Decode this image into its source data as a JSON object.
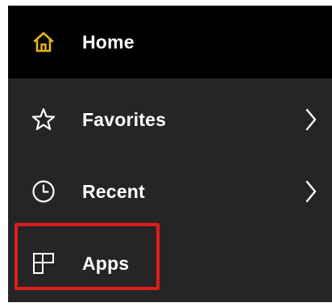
{
  "nav": {
    "items": [
      {
        "label": "Home",
        "icon": "home-icon",
        "selected": true
      },
      {
        "label": "Favorites",
        "icon": "star-icon",
        "has_submenu": true
      },
      {
        "label": "Recent",
        "icon": "clock-icon",
        "has_submenu": true
      },
      {
        "label": "Apps",
        "icon": "apps-icon",
        "highlighted": true
      }
    ]
  },
  "colors": {
    "panel_bg": "#252525",
    "selected_bg": "#000000",
    "home_icon": "#e8b41a",
    "text": "#ffffff",
    "highlight": "#e11c1c"
  }
}
